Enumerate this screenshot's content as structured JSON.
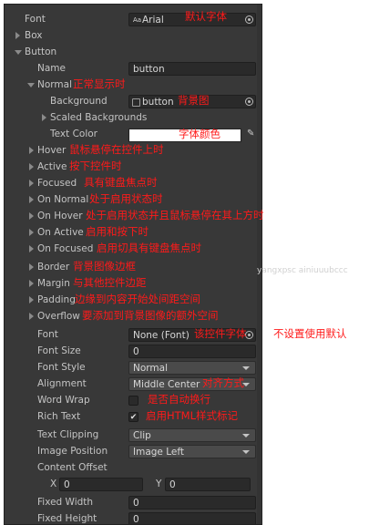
{
  "rows": {
    "font": {
      "label": "Font",
      "value": "Arial",
      "icon": "Aa",
      "note": "默认字体"
    },
    "box": {
      "label": "Box"
    },
    "button": {
      "label": "Button"
    },
    "name": {
      "label": "Name",
      "value": "button"
    },
    "normal": {
      "label": "Normal",
      "note": "正常显示时"
    },
    "background": {
      "label": "Background",
      "value": "button",
      "note": "背景图"
    },
    "scaled_backgrounds": {
      "label": "Scaled Backgrounds"
    },
    "text_color": {
      "label": "Text Color",
      "note": "字体颜色",
      "swatch": "#ffffff"
    },
    "hover": {
      "label": "Hover",
      "note": "鼠标悬停在控件上时"
    },
    "active": {
      "label": "Active",
      "note": "按下控件时"
    },
    "focused": {
      "label": "Focused",
      "note": "具有键盘焦点时"
    },
    "on_normal": {
      "label": "On Normal",
      "note": "处于启用状态时"
    },
    "on_hover": {
      "label": "On Hover",
      "note": "处于启用状态并且鼠标悬停在其上方时"
    },
    "on_active": {
      "label": "On Active",
      "note": "启用和按下时"
    },
    "on_focused": {
      "label": "On Focused",
      "note": "启用切具有键盘焦点时"
    },
    "border": {
      "label": "Border",
      "note": "背景图像边框"
    },
    "margin": {
      "label": "Margin",
      "note": "与其他控件边距"
    },
    "padding": {
      "label": "Padding",
      "note": "边缘到内容开始处间距空间"
    },
    "overflow": {
      "label": "Overflow",
      "note": "要添加到背景图像的额外空间"
    },
    "font2": {
      "label": "Font",
      "value": "None (Font)",
      "note": "该控件字体",
      "note2": "不设置使用默认"
    },
    "font_size": {
      "label": "Font Size",
      "value": "0"
    },
    "font_style": {
      "label": "Font Style",
      "value": "Normal"
    },
    "alignment": {
      "label": "Alignment",
      "value": "Middle Center",
      "note": "对齐方式"
    },
    "word_wrap": {
      "label": "Word Wrap",
      "checked": false,
      "note": "是否自动换行"
    },
    "rich_text": {
      "label": "Rich Text",
      "checked": true,
      "note": "启用HTML样式标记"
    },
    "text_clipping": {
      "label": "Text Clipping",
      "value": "Clip"
    },
    "image_position": {
      "label": "Image Position",
      "value": "Image Left"
    },
    "content_offset": {
      "label": "Content Offset",
      "x_label": "X",
      "x": "0",
      "y_label": "Y",
      "y": "0"
    },
    "fixed_width": {
      "label": "Fixed Width",
      "value": "0"
    },
    "fixed_height": {
      "label": "Fixed Height",
      "value": "0"
    }
  },
  "watermark": "yangxpsc ainiuuubccc"
}
